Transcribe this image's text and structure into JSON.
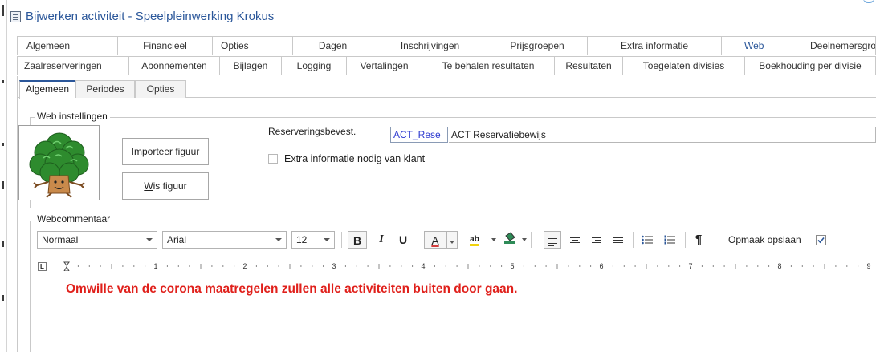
{
  "window": {
    "title": "Bijwerken activiteit - Speelpleinwerking Krokus"
  },
  "tabs_row1": [
    {
      "label": "Algemeen"
    },
    {
      "label": "Financieel"
    },
    {
      "label": "Opties"
    },
    {
      "label": "Dagen"
    },
    {
      "label": "Inschrijvingen"
    },
    {
      "label": "Prijsgroepen"
    },
    {
      "label": "Extra informatie"
    },
    {
      "label": "Web",
      "active": true
    },
    {
      "label": "Deelnemersgroe"
    }
  ],
  "tabs_row2": [
    {
      "label": "Zaalreserveringen"
    },
    {
      "label": "Abonnementen"
    },
    {
      "label": "Bijlagen"
    },
    {
      "label": "Logging"
    },
    {
      "label": "Vertalingen"
    },
    {
      "label": "Te behalen resultaten"
    },
    {
      "label": "Resultaten"
    },
    {
      "label": "Toegelaten divisies"
    },
    {
      "label": "Boekhouding per divisie"
    }
  ],
  "subtabs": [
    {
      "label": "Algemeen",
      "active": true
    },
    {
      "label": "Periodes"
    },
    {
      "label": "Opties"
    }
  ],
  "web_settings": {
    "group_title": "Web instellingen",
    "image_icon": "tree-mascot-icon",
    "import_button": {
      "prefix": "I",
      "rest": "mporteer figuur"
    },
    "clear_button": {
      "prefix": "W",
      "rest": "is figuur"
    },
    "reservation_label": "Reserveringsbevest.",
    "reservation_code": "ACT_Rese",
    "reservation_description": "ACT Reservatiebewijs",
    "extra_info_label": "Extra informatie nodig van klant",
    "extra_info_checked": false
  },
  "web_comment": {
    "group_title": "Webcommentaar",
    "toolbar": {
      "style_value": "Normaal",
      "font_value": "Arial",
      "size_value": "12",
      "bold": "B",
      "italic": "I",
      "underline": "U",
      "font_color": "A",
      "highlight": "ab",
      "paragraph": "¶",
      "save_format_label": "Opmaak opslaan",
      "save_format_checked": true
    },
    "ruler_numbers": [
      "1",
      "2",
      "3",
      "4",
      "5",
      "6",
      "7",
      "8",
      "9"
    ],
    "ruler_corner": "L",
    "content_text": "Omwille van de corona maatregelen zullen alle activiteiten buiten door gaan.",
    "content_color": "#e0201b"
  },
  "colors": {
    "accent": "#2b579a",
    "code_text": "#2d3ad0"
  }
}
